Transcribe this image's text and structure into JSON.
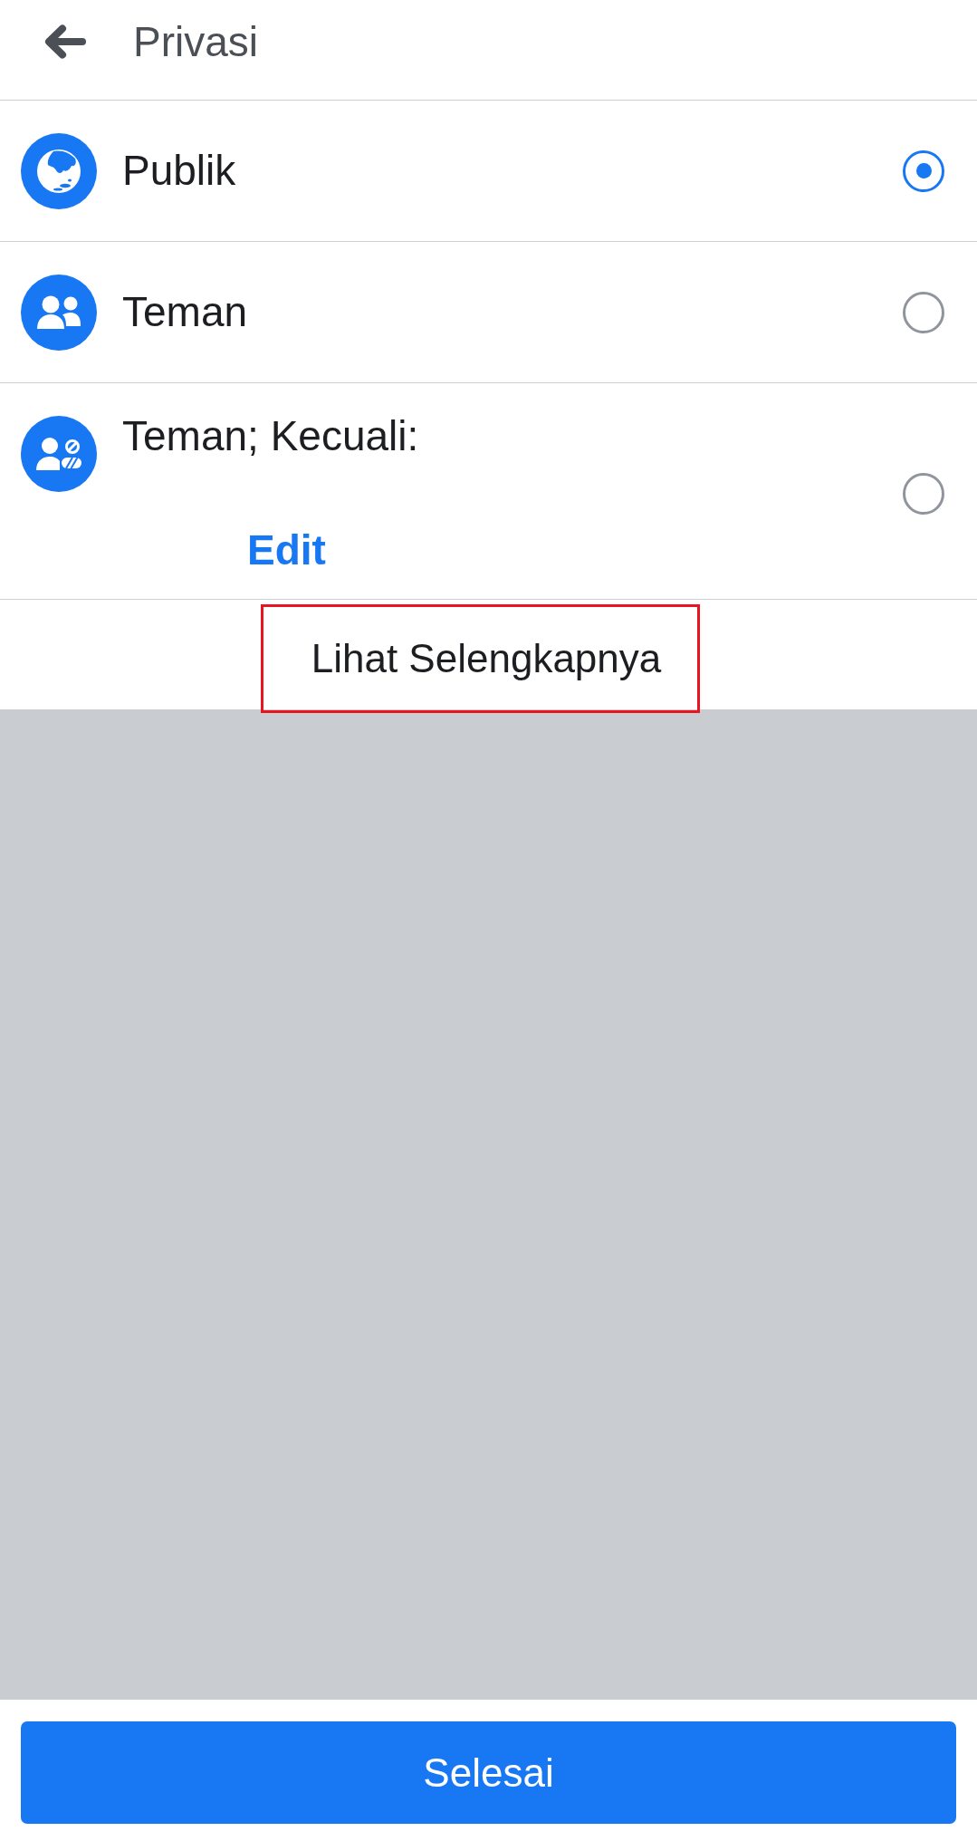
{
  "header": {
    "title": "Privasi"
  },
  "options": [
    {
      "kind": "public",
      "label": "Publik",
      "selected": true
    },
    {
      "kind": "friends",
      "label": "Teman",
      "selected": false
    },
    {
      "kind": "friends_except",
      "label": "Teman; Kecuali:",
      "link": "Edit",
      "selected": false
    }
  ],
  "see_more": {
    "label": "Lihat Selengkapnya",
    "highlighted": true
  },
  "done_button": {
    "label": "Selesai"
  }
}
